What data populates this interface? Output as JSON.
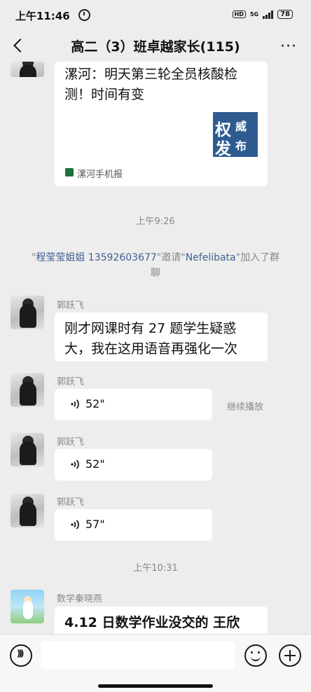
{
  "status_bar": {
    "time": "上午11:46",
    "hd": "HD",
    "network": "5G",
    "battery": "78"
  },
  "header": {
    "title": "高二（3）班卓越家长(115)",
    "more": "···"
  },
  "messages": {
    "link_card": {
      "title": "漯河：明天第三轮全员核酸检测！时间有变",
      "thumb": [
        "权",
        "威",
        "发",
        "布"
      ],
      "source": "漯河手机报"
    },
    "ts1": "上午9:26",
    "sys": {
      "q1": "\"",
      "inviter": "程莹莹姐姐 13592603677",
      "q2": "\"邀请\"",
      "invitee": "Nefelibata",
      "tail": "\"加入了群聊"
    },
    "m1": {
      "sender": "郭跃飞",
      "text": "刚才网课时有 27 题学生疑惑大，我在这用语音再强化一次"
    },
    "m2": {
      "sender": "郭跃飞",
      "duration": "52\"",
      "continue": "继续播放"
    },
    "m3": {
      "sender": "郭跃飞",
      "duration": "52\""
    },
    "m4": {
      "sender": "郭跃飞",
      "duration": "57\""
    },
    "ts2": "上午10:31",
    "m5": {
      "sender": "数学秦晓燕",
      "text": "4.12 日数学作业没交的  王欣"
    }
  }
}
